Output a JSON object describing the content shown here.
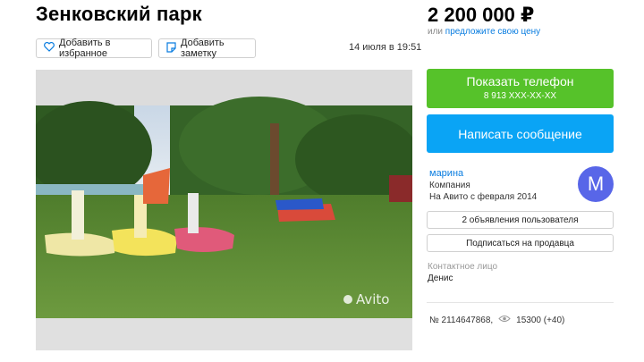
{
  "listing": {
    "title": "Зенковский парк",
    "date": "14 июля в 19:51",
    "add_favorite": "Добавить в избранное",
    "add_note": "Добавить заметку",
    "watermark": "Avito"
  },
  "pricing": {
    "price": "2 200 000 ₽",
    "or_text": "или",
    "offer_link": "предложите свою цену"
  },
  "contact": {
    "show_phone": "Показать телефон",
    "phone_masked": "8 913 XXX-XX-XX",
    "write_message": "Написать сообщение",
    "contact_label": "Контактное лицо",
    "contact_name": "Денис"
  },
  "seller": {
    "name": "марина",
    "type": "Компания",
    "since": "На Авито с февраля 2014",
    "avatar_letter": "M",
    "ads_button": "2 объявления пользователя",
    "subscribe_button": "Подписаться на продавца"
  },
  "stats": {
    "ad_number": "№ 2114647868,",
    "views": "15300 (+40)"
  },
  "colors": {
    "green": "#56c22a",
    "blue": "#0aa4f5",
    "link": "#0a7de0",
    "avatar": "#5866e8"
  }
}
